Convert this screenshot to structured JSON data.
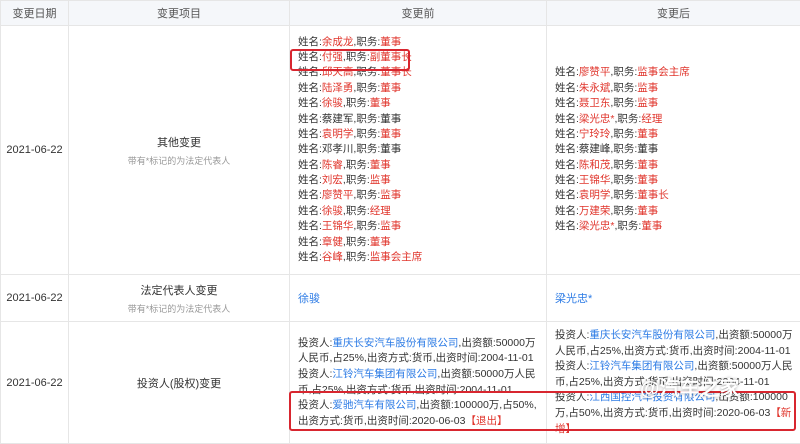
{
  "headers": [
    "变更日期",
    "变更项目",
    "变更前",
    "变更后"
  ],
  "rows": [
    {
      "date": "2021-06-22",
      "item": "其他变更",
      "note": "带有*标记的为法定代表人",
      "before": [
        {
          "name": "余成龙",
          "role": "董事",
          "red": true
        },
        {
          "name": "付强",
          "role": "副董事长",
          "red": true
        },
        {
          "name": "邱天高",
          "role": "董事长",
          "red": true
        },
        {
          "name": "陆泽勇",
          "role": "董事",
          "red": true
        },
        {
          "name": "徐骏",
          "role": "董事",
          "red": true
        },
        {
          "name": "蔡建军",
          "role": "董事",
          "red": false
        },
        {
          "name": "袁明学",
          "role": "董事",
          "red": true
        },
        {
          "name": "邓孝川",
          "role": "董事",
          "red": false
        },
        {
          "name": "陈睿",
          "role": "董事",
          "red": true
        },
        {
          "name": "刘宏",
          "role": "监事",
          "red": true
        },
        {
          "name": "廖赞平",
          "role": "监事",
          "red": true
        },
        {
          "name": "徐骏",
          "role": "经理",
          "red": true
        },
        {
          "name": "王锦华",
          "role": "监事",
          "red": true
        },
        {
          "name": "章健",
          "role": "董事",
          "red": true
        },
        {
          "name": "谷峰",
          "role": "监事会主席",
          "red": true
        }
      ],
      "after": [
        {
          "name": "廖赞平",
          "role": "监事会主席",
          "red": true
        },
        {
          "name": "朱永斌",
          "role": "监事",
          "red": true
        },
        {
          "name": "聂卫东",
          "role": "监事",
          "red": true
        },
        {
          "name": "梁光忠*",
          "role": "经理",
          "red": true
        },
        {
          "name": "宁玲玲",
          "role": "董事",
          "red": true
        },
        {
          "name": "蔡建峰",
          "role": "董事",
          "red": false
        },
        {
          "name": "陈和茂",
          "role": "董事",
          "red": true
        },
        {
          "name": "王锦华",
          "role": "董事",
          "red": true
        },
        {
          "name": "袁明学",
          "role": "董事长",
          "red": true
        },
        {
          "name": "万建荣",
          "role": "董事",
          "red": true
        },
        {
          "name": "梁光忠*",
          "role": "董事",
          "red": true
        }
      ]
    },
    {
      "date": "2021-06-22",
      "item": "法定代表人变更",
      "note": "带有*标记的为法定代表人",
      "before": "徐骏",
      "after": "梁光忠*"
    },
    {
      "date": "2021-06-22",
      "item": "投资人(股权)变更",
      "before": [
        {
          "prefix": "投资人:",
          "company": "重庆长安汽车股份有限公司",
          "rest": ",出资额:50000万人民币,占25%,出资方式:货币,出资时间:2004-11-01"
        },
        {
          "prefix": "投资人:",
          "company": "江铃汽车集团有限公司",
          "rest": ",出资额:50000万人民币,占25%,出资方式:货币,出资时间:2004-11-01"
        },
        {
          "prefix": "投资人:",
          "company": "爱驰汽车有限公司",
          "rest": ",出资额:100000万,占50%,出资方式:货币,出资时间:2020-06-03",
          "tag": "【退出】"
        }
      ],
      "after": [
        {
          "prefix": "投资人:",
          "company": "重庆长安汽车股份有限公司",
          "rest": ",出资额:50000万人民币,占25%,出资方式:货币,出资时间:2004-11-01"
        },
        {
          "prefix": "投资人:",
          "company": "江铃汽车集团有限公司",
          "rest": ",出资额:50000万人民币,占25%,出资方式:货币,出资时间:2004-11-01"
        },
        {
          "prefix": "投资人:",
          "company": "江西国控汽车投资有限公司",
          "rest": ",出资额:100000万,占50%,出资方式:货币,出资时间:2020-06-03",
          "tag": "【新增】"
        }
      ]
    }
  ],
  "labels": {
    "name_prefix": "姓名:",
    "role_prefix": ",职务:"
  },
  "watermark": "@汽车之家",
  "colors": {
    "red": "#e0352c",
    "link": "#2c7be5",
    "border": "#e6e6e6",
    "header_bg": "#f5f7fa"
  }
}
